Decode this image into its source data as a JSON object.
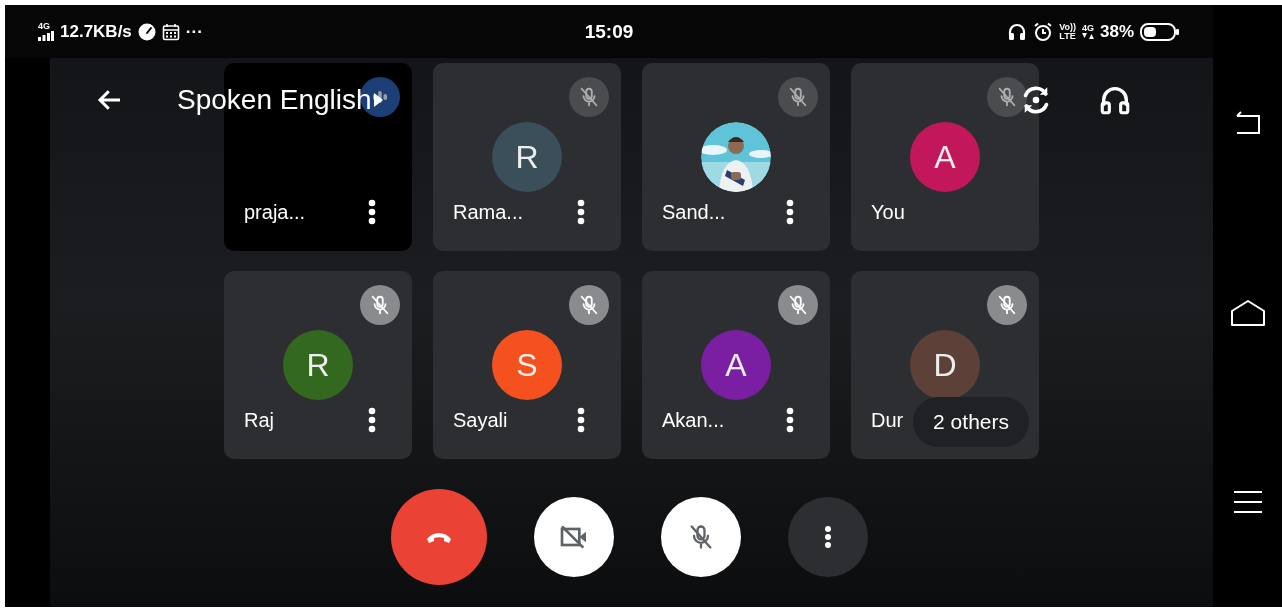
{
  "status_bar": {
    "signal_label": "4G",
    "speed": "12.7KB/s",
    "more": "···",
    "time": "15:09",
    "volte_top": "Vo))",
    "volte_bottom": "LTE",
    "network": "4G",
    "battery_text": "38%"
  },
  "header": {
    "title": "Spoken English"
  },
  "tiles": [
    {
      "kind": "camera",
      "name": "praja...",
      "mic_muted": false,
      "menu": true
    },
    {
      "kind": "avatar",
      "name": "Rama...",
      "mic_muted": true,
      "menu": true,
      "avatar": {
        "kind": "letter",
        "letter": "R",
        "color": "#3a4f5a"
      }
    },
    {
      "kind": "avatar",
      "name": "Sand...",
      "mic_muted": true,
      "menu": true
    },
    {
      "kind": "avatar",
      "name": "You",
      "mic_muted": true,
      "menu": false,
      "avatar": {
        "kind": "letter",
        "letter": "A",
        "color": "#c2185b"
      }
    },
    {
      "kind": "avatar",
      "name": "Raj",
      "mic_muted": true,
      "menu": true,
      "avatar": {
        "kind": "letter",
        "letter": "R",
        "color": "#33691e"
      }
    },
    {
      "kind": "avatar",
      "name": "Sayali",
      "mic_muted": true,
      "menu": true,
      "avatar": {
        "kind": "letter",
        "letter": "S",
        "color": "#f4511e"
      }
    },
    {
      "kind": "avatar",
      "name": "Akan...",
      "mic_muted": true,
      "menu": true,
      "avatar": {
        "kind": "letter",
        "letter": "A",
        "color": "#7b1fa2"
      }
    },
    {
      "kind": "avatar",
      "name": "Dur",
      "mic_muted": true,
      "menu": false,
      "avatar": {
        "kind": "letter",
        "letter": "D",
        "color": "#5d4037"
      },
      "chip": "2 others"
    }
  ],
  "controls": [
    {
      "kind": "hangup"
    },
    {
      "kind": "camera_off"
    },
    {
      "kind": "mic_off"
    },
    {
      "kind": "more"
    }
  ]
}
